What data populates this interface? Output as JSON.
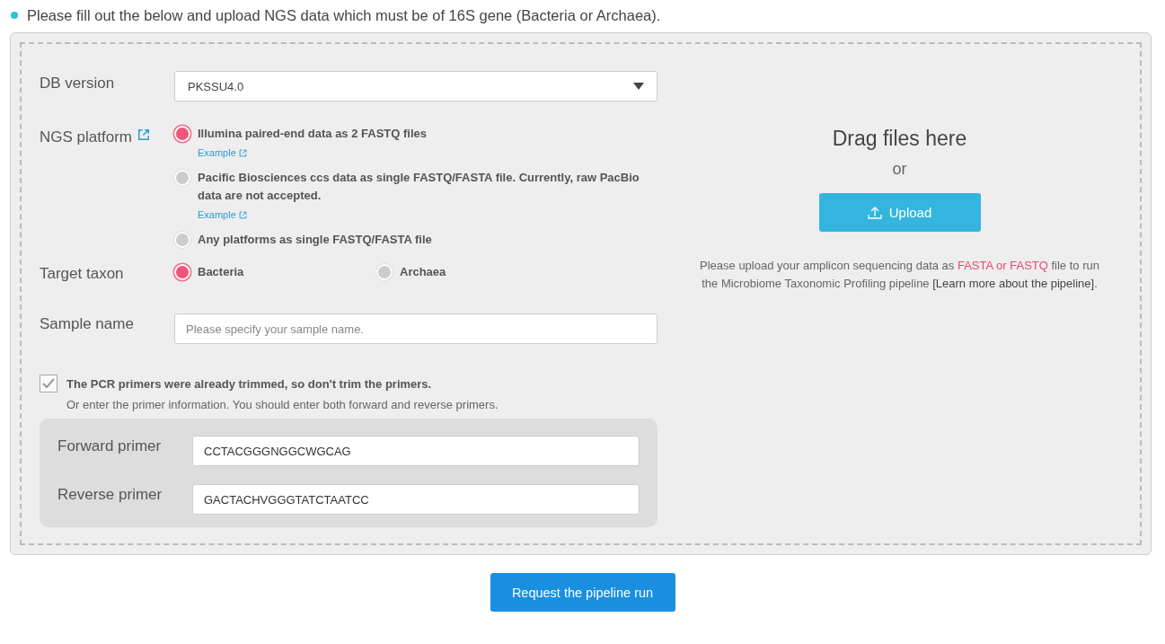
{
  "intro": "Please fill out the below and upload NGS data which must be of 16S gene (Bacteria or Archaea).",
  "db_version": {
    "label": "DB version",
    "value": "PKSSU4.0"
  },
  "ngs_platform": {
    "label": "NGS platform",
    "options": [
      {
        "label": "Illumina paired-end data as 2 FASTQ files",
        "link": "Example",
        "selected": true
      },
      {
        "label": "Pacific Biosciences ccs data as single FASTQ/FASTA file. Currently, raw PacBio data are not accepted.",
        "link": "Example",
        "selected": false
      },
      {
        "label": "Any platforms as single FASTQ/FASTA file",
        "selected": false
      }
    ]
  },
  "target_taxon": {
    "label": "Target taxon",
    "options": [
      {
        "label": "Bacteria",
        "selected": true
      },
      {
        "label": "Archaea",
        "selected": false
      }
    ]
  },
  "sample_name": {
    "label": "Sample name",
    "placeholder": "Please specify your sample name."
  },
  "trimmed": {
    "label": "The PCR primers were already trimmed, so don't trim the primers.",
    "checked": true,
    "hint": "Or enter the primer information. You should enter both forward and reverse primers."
  },
  "primers": [
    {
      "label": "Forward primer",
      "value": "CCTACGGGNGGCWGCAG"
    },
    {
      "label": "Reverse primer",
      "value": "GACTACHVGGGTATCTAATCC"
    }
  ],
  "dropzone": {
    "title": "Drag files here",
    "or": "or",
    "button": "Upload",
    "note": [
      {
        "kind": "plain",
        "text": "Please upload your amplicon sequencing data as "
      },
      {
        "kind": "highlight",
        "text": "FASTA or FASTQ"
      },
      {
        "kind": "plain",
        "text": " file to run the Microbiome Taxonomic Profiling pipeline "
      },
      {
        "kind": "dark",
        "text": "[Learn more about the pipeline]"
      },
      {
        "kind": "plain",
        "text": "."
      }
    ]
  },
  "submit": "Request the pipeline run"
}
